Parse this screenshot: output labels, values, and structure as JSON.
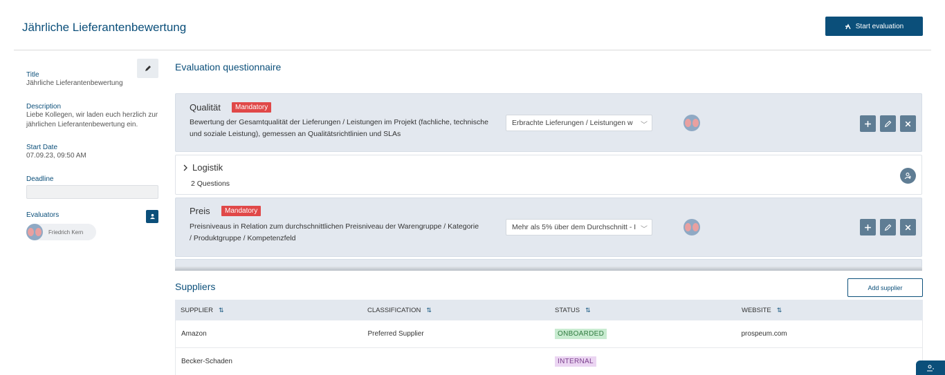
{
  "header": {
    "title": "Jährliche Lieferantenbewertung",
    "start_label": "Start evaluation"
  },
  "sidebar": {
    "title_label": "Title",
    "title_value": "Jährliche Lieferantenbewertung",
    "description_label": "Description",
    "description_value": "Liebe Kollegen, wir laden euch herzlich zur jährlichen Lieferantenbewertung ein.",
    "start_date_label": "Start Date",
    "start_date_value": "07.09.23, 09:50 AM",
    "deadline_label": "Deadline",
    "deadline_value": "",
    "evaluators_label": "Evaluators",
    "evaluators": [
      {
        "name": "Friedrich Kern"
      }
    ]
  },
  "questionnaire": {
    "title": "Evaluation questionnaire",
    "questions": [
      {
        "title": "Qualität",
        "badge": "Mandatory",
        "text": "Bewertung der Gesamtqualität der Lieferungen / Leistungen im Projekt (fachliche, technische und soziale Leistung), gemessen an Qualitätsrichtlinien und SLAs",
        "select_value": "Erbrachte Lieferungen / Leistungen w"
      },
      {
        "title": "Logistik",
        "subtitle": "2 Questions"
      },
      {
        "title": "Preis",
        "badge": "Mandatory",
        "text": "Preisniveaus in Relation zum durchschnittlichen Preisniveau der Warengruppe / Kategorie / Produktgruppe / Kompetenzfeld",
        "select_value": "Mehr als 5% über dem Durchschnitt - I"
      }
    ]
  },
  "suppliers": {
    "title": "Suppliers",
    "add_label": "Add supplier",
    "columns": [
      "SUPPLIER",
      "CLASSIFICATION",
      "STATUS",
      "WEBSITE"
    ],
    "sort_glyph": "⇅",
    "rows": [
      {
        "supplier": "Amazon",
        "classification": "Preferred Supplier",
        "status": "ONBOARDED",
        "website": "prospeum.com"
      },
      {
        "supplier": "Becker-Schaden",
        "classification": "",
        "status": "INTERNAL",
        "website": ""
      }
    ]
  },
  "colors": {
    "primary": "#0b4f7a",
    "mandatory": "#e04848",
    "card_gray": "#e3e8ef",
    "icon_button": "#5f7d94",
    "onboarded_bg": "#c8ebd0",
    "internal_bg": "#ebd5f2"
  }
}
